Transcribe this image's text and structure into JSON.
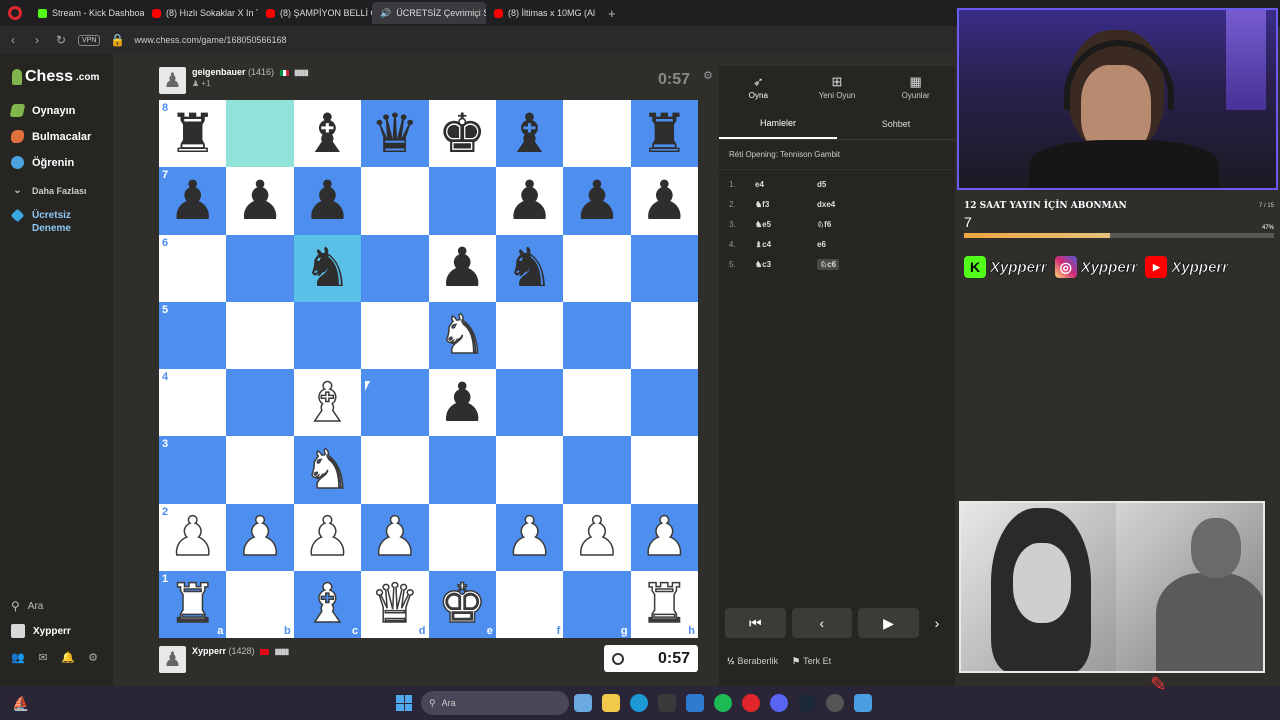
{
  "browser": {
    "tabs": [
      {
        "label": "Stream - Kick Dashboard",
        "icon": "kick-icon"
      },
      {
        "label": "(8) Hızlı Sokaklar X In The",
        "icon": "youtube-icon"
      },
      {
        "label": "(8) ŞAMPİYON BELLİ C",
        "icon": "youtube-icon"
      },
      {
        "label": "ÜCRETSİZ Çevrimiçi S",
        "icon": "speaker-icon",
        "active": true
      },
      {
        "label": "(8) İltimas x 10MG (Al",
        "icon": "youtube-icon"
      }
    ],
    "url": "www.chess.com/game/168050566168",
    "vpn_label": "VPN"
  },
  "sidebar": {
    "logo_text": "Chess",
    "logo_suffix": ".com",
    "items": [
      {
        "label": "Oynayın",
        "icon": "play-icon"
      },
      {
        "label": "Bulmacalar",
        "icon": "puzzle-icon"
      },
      {
        "label": "Öğrenin",
        "icon": "learn-icon"
      },
      {
        "label": "Daha Fazlası",
        "icon": "chevron-down-icon"
      },
      {
        "label": "Ücretsiz Deneme",
        "icon": "diamond-icon"
      }
    ],
    "search_label": "Ara",
    "user_label": "Xypperr"
  },
  "top_player": {
    "name": "geigenbauer",
    "rating": "(1416)",
    "sub": "+1",
    "clock": "0:57"
  },
  "bottom_player": {
    "name": "Xypperr",
    "rating": "(1428)",
    "clock": "0:57"
  },
  "board": {
    "ranks": [
      "8",
      "7",
      "6",
      "5",
      "4",
      "3",
      "2",
      "1"
    ],
    "files": [
      "a",
      "b",
      "c",
      "d",
      "e",
      "f",
      "g",
      "h"
    ],
    "position": [
      [
        "bR",
        "",
        "bB",
        "bQ",
        "bK",
        "bB",
        "",
        "bR"
      ],
      [
        "bP",
        "bP",
        "bP",
        "",
        "",
        "bP",
        "bP",
        "bP"
      ],
      [
        "",
        "",
        "bN",
        "",
        "bP",
        "bN",
        "",
        ""
      ],
      [
        "",
        "",
        "",
        "",
        "wN",
        "",
        "",
        ""
      ],
      [
        "",
        "",
        "wB",
        "",
        "bP",
        "",
        "",
        ""
      ],
      [
        "",
        "",
        "wN",
        "",
        "",
        "",
        "",
        ""
      ],
      [
        "wP",
        "wP",
        "wP",
        "wP",
        "",
        "wP",
        "wP",
        "wP"
      ],
      [
        "wR",
        "",
        "wB",
        "wQ",
        "wK",
        "",
        "",
        "wR"
      ]
    ],
    "highlight": [
      "b8",
      "c6"
    ]
  },
  "right_panel": {
    "top_tabs": [
      {
        "label": "Oyna",
        "icon": "play-icon",
        "active": true
      },
      {
        "label": "Yeni Oyun",
        "icon": "plus-icon"
      },
      {
        "label": "Oyunlar",
        "icon": "grid-icon"
      }
    ],
    "tabs": [
      {
        "label": "Hamleler",
        "active": true
      },
      {
        "label": "Sohbet"
      }
    ],
    "opening": "Réti Opening: Tennison Gambit",
    "moves": [
      {
        "n": "1.",
        "w": "e4",
        "b": "d5"
      },
      {
        "n": "2.",
        "w": "♞f3",
        "b": "dxe4"
      },
      {
        "n": "3.",
        "w": "♞e5",
        "b": "♘f6"
      },
      {
        "n": "4.",
        "w": "♝c4",
        "b": "e6"
      },
      {
        "n": "5.",
        "w": "♞c3",
        "b": "♘c6"
      }
    ],
    "draw_label": "Beraberlik",
    "resign_label": "Terk Et"
  },
  "overlay": {
    "sub_goal_title": "12 SAAT YAYIN İÇİN ABONMAN",
    "sub_goal_count": "7 / 15",
    "sub_goal_value": "7",
    "sub_goal_percent": "47%",
    "sub_goal_fraction": 0.47,
    "socials": [
      "Xypperr",
      "Xypperr",
      "Xypperr"
    ]
  },
  "taskbar": {
    "search_label": "Ara"
  }
}
